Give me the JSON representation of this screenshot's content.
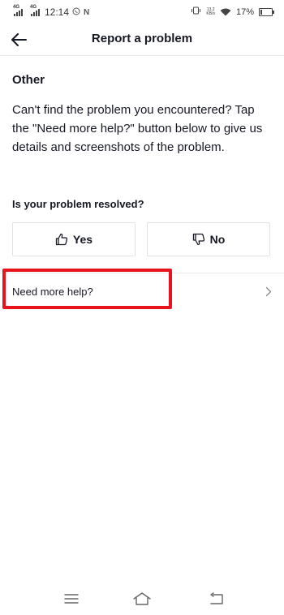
{
  "status_bar": {
    "network_1": "4G",
    "network_2": "4G",
    "time": "12:14",
    "app_icons": [
      "whatsapp-icon",
      "n-app-icon"
    ],
    "speed_value": "13.2",
    "speed_unit": "KB/s",
    "battery": "17%",
    "battery_level": 0.17
  },
  "header": {
    "title": "Report a problem",
    "back_icon": "arrow-left-icon"
  },
  "content": {
    "section_title": "Other",
    "description": "Can't find the problem you encountered? Tap the \"Need more help?\" button below to give us details and screenshots of the problem.",
    "question": "Is your problem resolved?",
    "yes_label": "Yes",
    "yes_icon": "thumbs-up-icon",
    "no_label": "No",
    "no_icon": "thumbs-down-icon",
    "help_label": "Need more help?",
    "help_icon": "chevron-right-icon",
    "highlight_color": "#e8141b"
  },
  "nav_bar": {
    "icons": [
      "menu-icon",
      "home-icon",
      "back-icon"
    ]
  }
}
